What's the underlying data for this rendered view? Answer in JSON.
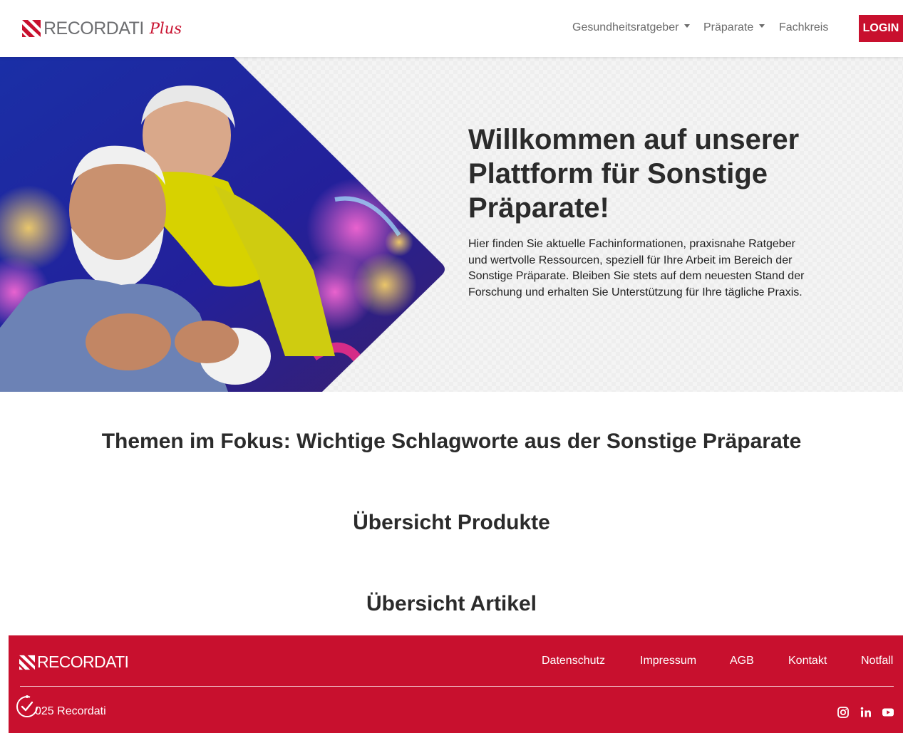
{
  "header": {
    "brand": "RECORDATI",
    "brand_suffix": "Plus",
    "nav": [
      {
        "label": "Gesundheitsratgeber",
        "dropdown": true
      },
      {
        "label": "Präparate",
        "dropdown": true
      },
      {
        "label": "Fachkreis",
        "dropdown": false
      }
    ],
    "login_label": "LOGIN"
  },
  "hero": {
    "title": "Willkommen auf unserer Plattform für Sonstige Präparate!",
    "text": "Hier finden Sie aktuelle Fachinformationen, praxisnahe Ratgeber und wertvolle Ressourcen, speziell für Ihre Arbeit im Bereich der Sonstige Präparate. Bleiben Sie stets auf dem neuesten Stand der Forschung und erhalten Sie Unterstützung für Ihre tägliche Praxis."
  },
  "sections": {
    "focus_title": "Themen im Fokus: Wichtige Schlagworte aus der Sonstige Präparate",
    "products_title": "Übersicht Produkte",
    "articles_title": "Übersicht Artikel"
  },
  "footer": {
    "brand": "RECORDATI",
    "links": [
      "Datenschutz",
      "Impressum",
      "AGB",
      "Kontakt",
      "Notfall"
    ],
    "copyright": "025 Recordati",
    "social": [
      "instagram-icon",
      "linkedin-icon",
      "youtube-icon"
    ]
  },
  "colors": {
    "brand_red": "#c8102e",
    "text_dark": "#2b2b2b",
    "nav_grey": "#6b6b6b"
  }
}
